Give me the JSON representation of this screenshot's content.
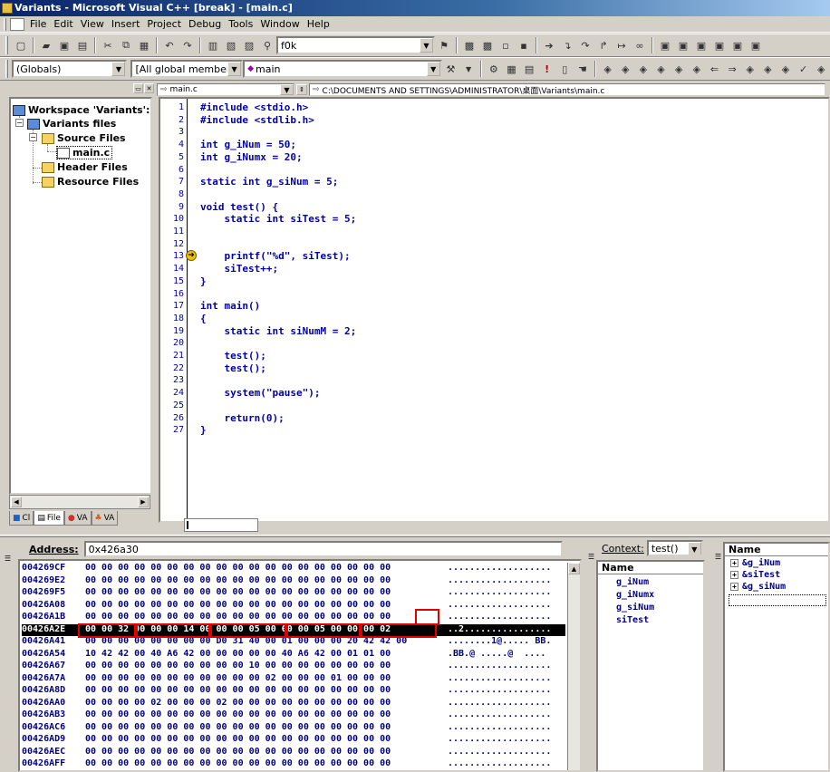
{
  "window": {
    "title": "Variants - Microsoft Visual C++ [break] - [main.c]"
  },
  "menu": [
    "File",
    "Edit",
    "View",
    "Insert",
    "Project",
    "Debug",
    "Tools",
    "Window",
    "Help"
  ],
  "toolbar1": {
    "find_value": "f0k"
  },
  "toolbar2": {
    "scope": "(Globals)",
    "members": "[All global members",
    "function": "main"
  },
  "workspace": {
    "root": "Workspace 'Variants':",
    "project": "Variants files",
    "source_folder": "Source Files",
    "file": "main.c",
    "header_folder": "Header Files",
    "resource_folder": "Resource Files",
    "tabs": [
      "Cl",
      "File",
      "VA",
      "VA"
    ]
  },
  "editor": {
    "tab_file": "main.c",
    "path": "C:\\DOCUMENTS AND SETTINGS\\ADMINISTRATOR\\桌面\\Variants\\main.c",
    "lines": [
      "#include <stdio.h>",
      "#include <stdlib.h>",
      "",
      "int g_iNum = 50;",
      "int g_iNumx = 20;",
      "",
      "static int g_siNum = 5;",
      "",
      "void test() {",
      "    static int siTest = 5;",
      "",
      "",
      "    printf(\"%d\", siTest);",
      "    siTest++;",
      "}",
      "",
      "int main()",
      "{",
      "    static int siNumM = 2;",
      "",
      "    test();",
      "    test();",
      "",
      "    system(\"pause\");",
      "",
      "    return(0);",
      "}"
    ],
    "current_line": 13
  },
  "memory": {
    "address_label": "Address:",
    "address_value": "0x426a30",
    "rows": [
      {
        "addr": "004269CF",
        "bytes": "00 00 00 00 00 00 00 00 00 00 00 00 00 00 00 00 00 00 00",
        "ascii": "...................",
        "hi": false
      },
      {
        "addr": "004269E2",
        "bytes": "00 00 00 00 00 00 00 00 00 00 00 00 00 00 00 00 00 00 00",
        "ascii": "...................",
        "hi": false
      },
      {
        "addr": "004269F5",
        "bytes": "00 00 00 00 00 00 00 00 00 00 00 00 00 00 00 00 00 00 00",
        "ascii": "...................",
        "hi": false
      },
      {
        "addr": "00426A08",
        "bytes": "00 00 00 00 00 00 00 00 00 00 00 00 00 00 00 00 00 00 00",
        "ascii": "...................",
        "hi": false
      },
      {
        "addr": "00426A1B",
        "bytes": "00 00 00 00 00 00 00 00 00 00 00 00 00 00 00 00 00 00 00",
        "ascii": "...................",
        "hi": false
      },
      {
        "addr": "00426A2E",
        "bytes": "00 00 32 00 00 00 14 00 00 00 05 00 00 00 05 00 00 00 02",
        "ascii": "..2................",
        "hi": true
      },
      {
        "addr": "00426A41",
        "bytes": "00 00 00 00 00 00 00 00 D0 31 40 00 01 00 00 00 20 42 42 00",
        "ascii": "........1@..... BB.",
        "hi": false
      },
      {
        "addr": "00426A54",
        "bytes": "10 42 42 00 40 A6 42 00 00 00 00 00 40 A6 42 00 01 01 00",
        "ascii": ".BB.@ .....@  ....",
        "hi": false
      },
      {
        "addr": "00426A67",
        "bytes": "00 00 00 00 00 00 00 00 00 00 10 00 00 00 00 00 00 00 00",
        "ascii": "...................",
        "hi": false
      },
      {
        "addr": "00426A7A",
        "bytes": "00 00 00 00 00 00 00 00 00 00 00 02 00 00 00 01 00 00 00",
        "ascii": "...................",
        "hi": false
      },
      {
        "addr": "00426A8D",
        "bytes": "00 00 00 00 00 00 00 00 00 00 00 00 00 00 00 00 00 00 00",
        "ascii": "...................",
        "hi": false
      },
      {
        "addr": "00426AA0",
        "bytes": "00 00 00 00 02 00 00 00 02 00 00 00 00 00 00 00 00 00 00",
        "ascii": "...................",
        "hi": false
      },
      {
        "addr": "00426AB3",
        "bytes": "00 00 00 00 00 00 00 00 00 00 00 00 00 00 00 00 00 00 00",
        "ascii": "...................",
        "hi": false
      },
      {
        "addr": "00426AC6",
        "bytes": "00 00 00 00 00 00 00 00 00 00 00 00 00 00 00 00 00 00 00",
        "ascii": "...................",
        "hi": false
      },
      {
        "addr": "00426AD9",
        "bytes": "00 00 00 00 00 00 00 00 00 00 00 00 00 00 00 00 00 00 00",
        "ascii": "...................",
        "hi": false
      },
      {
        "addr": "00426AEC",
        "bytes": "00 00 00 00 00 00 00 00 00 00 00 00 00 00 00 00 00 00 00",
        "ascii": "...................",
        "hi": false
      },
      {
        "addr": "00426AFF",
        "bytes": "00 00 00 00 00 00 00 00 00 00 00 00 00 00 00 00 00 00 00",
        "ascii": "...................",
        "hi": false
      }
    ]
  },
  "variables": {
    "context_label": "Context:",
    "context_value": "test()",
    "header": "Name",
    "items": [
      "g_iNum",
      "g_iNumx",
      "g_siNum",
      "siTest"
    ]
  },
  "watch": {
    "header": "Name",
    "items": [
      "&g_iNum",
      "&siTest",
      "&g_siNum"
    ]
  }
}
